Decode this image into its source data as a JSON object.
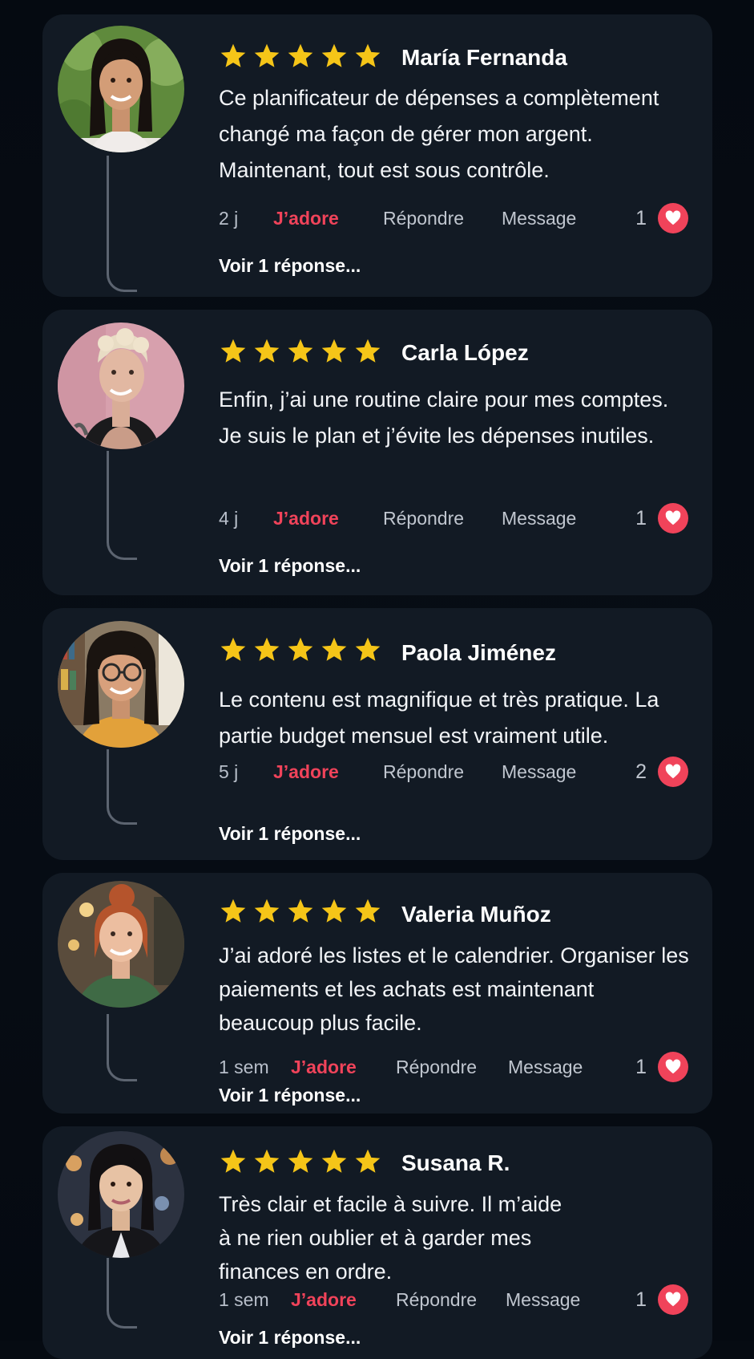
{
  "colors": {
    "background": "#060b12",
    "card": "#121a24",
    "star": "#f5c518",
    "accent_red": "#f0435a",
    "thread_line": "#5c6470"
  },
  "icons": {
    "star": "star-icon",
    "heart": "heart-icon"
  },
  "reviews": [
    {
      "rating": 5,
      "name": "María Fernanda",
      "text": "Ce planificateur de dépenses a complètement changé ma façon de gérer mon argent. Maintenant, tout est sous contrôle.",
      "time": "2 j",
      "love_label": "J’adore",
      "reply_label": "Répondre",
      "message_label": "Message",
      "like_count": "1",
      "view_replies": "Voir 1 réponse..."
    },
    {
      "rating": 5,
      "name": "Carla López",
      "text": "Enfin, j’ai une routine claire pour mes comptes. Je suis le plan et j’évite les dépenses inutiles.",
      "time": "4 j",
      "love_label": "J’adore",
      "reply_label": "Répondre",
      "message_label": "Message",
      "like_count": "1",
      "view_replies": "Voir 1 réponse..."
    },
    {
      "rating": 5,
      "name": "Paola Jiménez",
      "text": "Le contenu est magnifique et très pratique. La partie budget mensuel est vraiment utile.",
      "time": "5 j",
      "love_label": "J’adore",
      "reply_label": "Répondre",
      "message_label": "Message",
      "like_count": "2",
      "view_replies": "Voir 1 réponse..."
    },
    {
      "rating": 5,
      "name": "Valeria Muñoz",
      "text": "J’ai adoré les listes et le calendrier. Organiser les paiements et les achats est maintenant beaucoup plus facile.",
      "time": "1 sem",
      "love_label": "J’adore",
      "reply_label": "Répondre",
      "message_label": "Message",
      "like_count": "1",
      "view_replies": "Voir 1 réponse..."
    },
    {
      "rating": 5,
      "name": "Susana R.",
      "text": "Très clair et facile à suivre. Il m’aide à ne rien oublier et à garder mes finances en ordre.",
      "time": "1 sem",
      "love_label": "J’adore",
      "reply_label": "Répondre",
      "message_label": "Message",
      "like_count": "1",
      "view_replies": "Voir 1 réponse..."
    }
  ]
}
